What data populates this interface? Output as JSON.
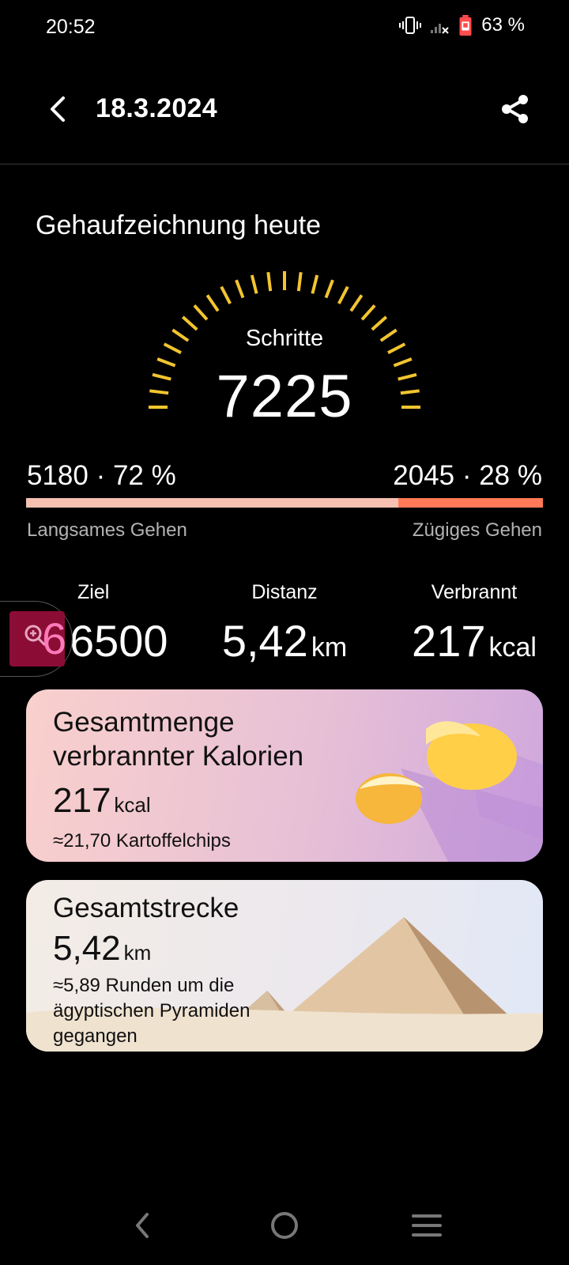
{
  "status_bar": {
    "time": "20:52",
    "battery_percent": "63 %",
    "icons": [
      "vibrate-icon",
      "signal-off-icon",
      "battery-icon"
    ]
  },
  "header": {
    "date": "18.3.2024",
    "back_icon": "chevron-left-icon",
    "share_icon": "share-icon"
  },
  "section_title": "Gehaufzeichnung heute",
  "gauge": {
    "label": "Schritte",
    "value": "7225",
    "color": "#f2c42f"
  },
  "split": {
    "slow_value": "5180 · 72 %",
    "fast_value": "2045 · 28 %",
    "slow_label": "Langsames Gehen",
    "fast_label": "Zügiges Gehen",
    "slow_fraction": 0.72,
    "fast_fraction": 0.28,
    "slow_color": "#f6c1b1",
    "fast_color": "#ff7a57"
  },
  "stats": {
    "goal": {
      "label": "Ziel",
      "value": "6500"
    },
    "distance": {
      "label": "Distanz",
      "value": "5,42",
      "unit": "km"
    },
    "burned": {
      "label": "Verbrannt",
      "value": "217",
      "unit": "kcal"
    }
  },
  "zoom_widget": {
    "icon": "zoom-in-icon",
    "overlay_digit": "6"
  },
  "calories_card": {
    "title_line1": "Gesamtmenge",
    "title_line2": "verbrannter Kalorien",
    "value": "217",
    "unit": "kcal",
    "subtitle": "≈21,70 Kartoffelchips"
  },
  "distance_card": {
    "title": "Gesamtstrecke",
    "value": "5,42",
    "unit": "km",
    "subtitle_line1": "≈5,89 Runden um die",
    "subtitle_line2": "ägyptischen Pyramiden",
    "subtitle_line3": "gegangen"
  },
  "navbar": {
    "icons": [
      "nav-back-icon",
      "nav-home-icon",
      "nav-recents-icon"
    ]
  }
}
